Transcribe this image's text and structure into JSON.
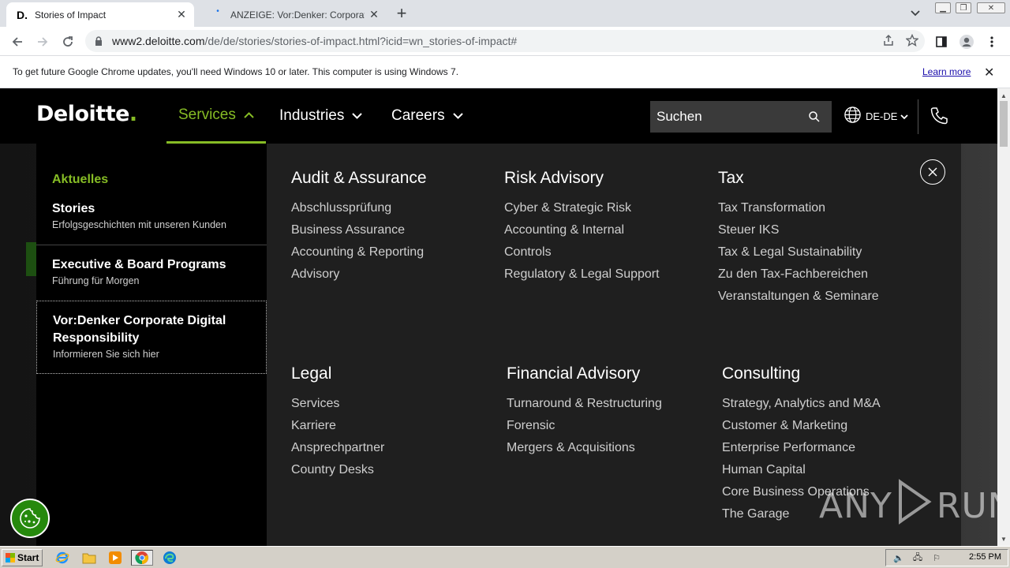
{
  "browser": {
    "tabs": [
      {
        "title": "Stories of Impact",
        "favicon": "D.",
        "active": true
      },
      {
        "title": "ANZEIGE: Vor:Denker: Corporate Di",
        "active": false
      }
    ],
    "url_host": "www2.deloitte.com",
    "url_path": "/de/de/stories/stories-of-impact.html?icid=wn_stories-of-impact#",
    "infobar_message": "To get future Google Chrome updates, you'll need Windows 10 or later. This computer is using Windows 7.",
    "infobar_link": "Learn more"
  },
  "site": {
    "logo_text": "Deloitte",
    "logo_dot": ".",
    "nav": [
      {
        "label": "Services",
        "active": true
      },
      {
        "label": "Industries",
        "active": false
      },
      {
        "label": "Careers",
        "active": false
      }
    ],
    "search_placeholder": "Suchen",
    "language": "DE-DE"
  },
  "mega_menu": {
    "left_heading": "Aktuelles",
    "left_items": [
      {
        "title": "Stories",
        "subtitle": "Erfolgsgeschichten mit unseren Kunden"
      },
      {
        "title": "Executive & Board Programs",
        "subtitle": "Führung für Morgen"
      },
      {
        "title": "Vor:Denker Corporate Digital Responsibility",
        "subtitle": "Informieren Sie sich hier"
      }
    ],
    "columns": [
      {
        "heading": "Audit & Assurance",
        "links": [
          "Abschlussprüfung",
          "Business Assurance",
          "Accounting & Reporting",
          "Advisory"
        ]
      },
      {
        "heading": "Risk Advisory",
        "links": [
          "Cyber & Strategic Risk",
          "Accounting & Internal",
          "Controls",
          "Regulatory & Legal Support"
        ]
      },
      {
        "heading": "Tax",
        "links": [
          "Tax Transformation",
          "Steuer IKS",
          "Tax & Legal Sustainability",
          "Zu den Tax-Fachbereichen",
          "Veranstaltungen & Seminare"
        ]
      },
      {
        "heading": "Legal",
        "links": [
          "Services",
          "Karriere",
          "Ansprechpartner",
          "Country Desks"
        ]
      },
      {
        "heading": "Financial Advisory",
        "links": [
          "Turnaround & Restructuring",
          "Forensic",
          "Mergers & Acquisitions"
        ]
      },
      {
        "heading": "Consulting",
        "links": [
          "Strategy, Analytics and M&A",
          "Customer & Marketing",
          "Enterprise Performance",
          "Human Capital",
          "Core Business Operations",
          "The Garage"
        ]
      }
    ]
  },
  "watermark": {
    "left": "ANY",
    "right": "RUN"
  },
  "taskbar": {
    "start_label": "Start",
    "clock": "2:55 PM"
  },
  "colors": {
    "brand_green": "#86bc25",
    "dark_green": "#26890d"
  }
}
